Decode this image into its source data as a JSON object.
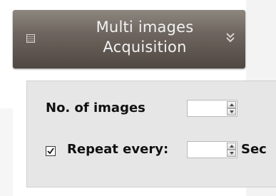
{
  "header": {
    "title_line1": "Multi images",
    "title_line2": "Acquisition",
    "icon": "list-icon",
    "chevron_icon": "chevron-double-down-icon"
  },
  "panel": {
    "num_images_label": "No. of images",
    "num_images_value": "",
    "repeat_checked": true,
    "repeat_label": "Repeat every:",
    "repeat_value": "",
    "unit_label": "Sec"
  }
}
